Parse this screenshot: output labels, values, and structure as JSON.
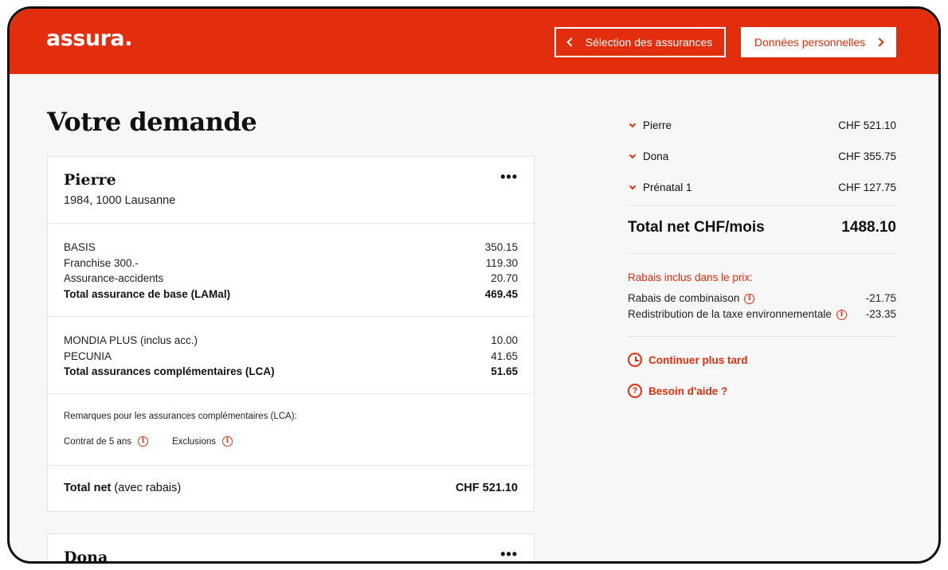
{
  "header": {
    "logo": "assura.",
    "back_label": "Sélection des assurances",
    "next_label": "Données personnelles"
  },
  "page_title": "Votre demande",
  "card": {
    "name": "Pierre",
    "subtitle": "1984, 1000 Lausanne",
    "menu": "•••",
    "base_rows": [
      {
        "label": "BASIS",
        "value": "350.15"
      },
      {
        "label": "Franchise 300.-",
        "value": "119.30"
      },
      {
        "label": "Assurance-accidents",
        "value": "20.70"
      }
    ],
    "base_total": {
      "label": "Total assurance de base (LAMal)",
      "value": "469.45"
    },
    "lca_rows": [
      {
        "label": "MONDIA PLUS (inclus acc.)",
        "value": "10.00"
      },
      {
        "label": "PECUNIA",
        "value": "41.65"
      }
    ],
    "lca_total": {
      "label": "Total assurances complémentaires (LCA)",
      "value": "51.65"
    },
    "remarks_title": "Remarques pour les assurances complémentaires (LCA):",
    "remarks": [
      "Contrat de 5 ans",
      "Exclusions"
    ],
    "total_net_label": "Total net",
    "total_net_suffix": "(avec rabais)",
    "total_net_value": "CHF 521.10"
  },
  "card2": {
    "name": "Dona",
    "menu": "•••"
  },
  "summary": {
    "persons": [
      {
        "name": "Pierre",
        "amount": "CHF 521.10"
      },
      {
        "name": "Dona",
        "amount": "CHF 355.75"
      },
      {
        "name": "Prénatal 1",
        "amount": "CHF 127.75"
      }
    ],
    "total_label": "Total net CHF/mois",
    "total_value": "1488.10",
    "rabais_title": "Rabais inclus dans le prix:",
    "rabais": [
      {
        "label": "Rabais de combinaison",
        "value": "-21.75"
      },
      {
        "label": "Redistribution de la taxe environnementale",
        "value": "-23.35"
      }
    ],
    "continue_label": "Continuer plus tard",
    "help_label": "Besoin d'aide ?"
  },
  "icons": {
    "info": "i",
    "help": "?"
  },
  "colors": {
    "brand": "#e22e0c"
  }
}
